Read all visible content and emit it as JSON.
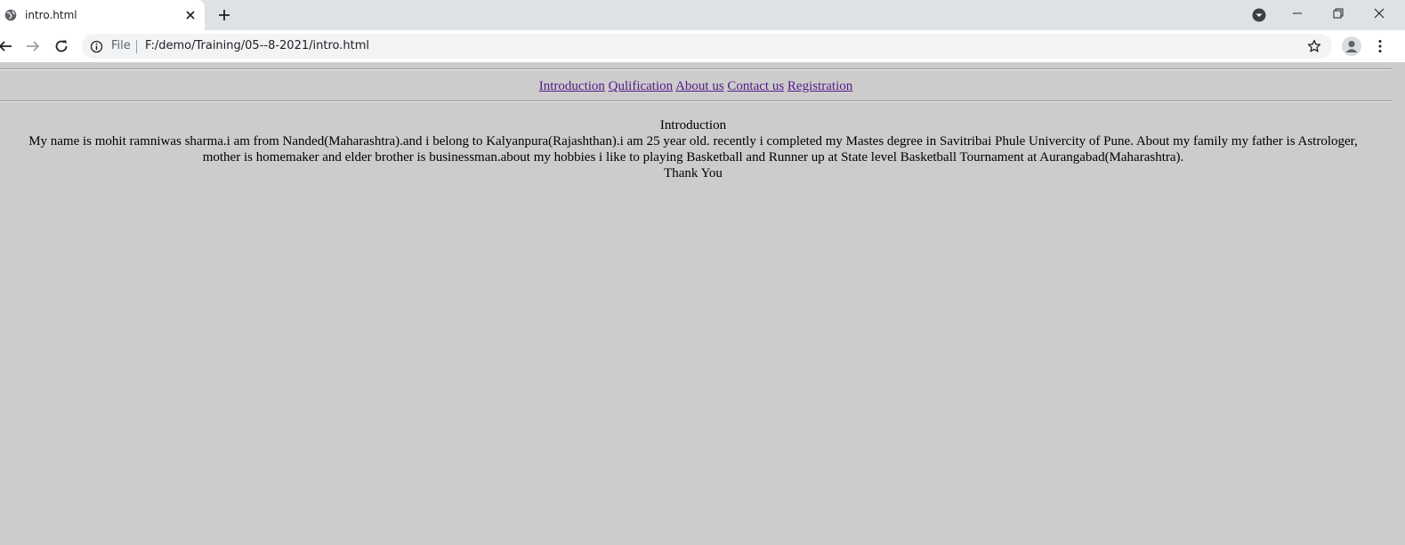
{
  "browser": {
    "tab": {
      "title": "intro.html",
      "favicon": "globe-icon"
    },
    "new_tab_icon": "plus-icon",
    "address": {
      "chip_label": "File",
      "url": "F:/demo/Training/05--8-2021/intro.html"
    }
  },
  "page": {
    "nav_links": [
      "Introduction",
      "Qulification",
      "About us",
      "Contact us",
      "Registration"
    ],
    "heading": "Introduction",
    "body_text": "My name is mohit ramniwas sharma.i am from Nanded(Maharashtra).and i belong to Kalyanpura(Rajashthan).i am 25 year old. recently i completed my Mastes degree in Savitribai Phule Univercity of Pune. About my family my father is Astrologer, mother is homemaker and elder brother is businessman.about my hobbies i like to playing Basketball and Runner up at State level Basketball Tournament at Aurangabad(Maharashtra).",
    "closing": "Thank You"
  },
  "colors": {
    "page_background": "#cccccc",
    "link_visited": "#551a8b",
    "tabstrip": "#dee1e6"
  }
}
